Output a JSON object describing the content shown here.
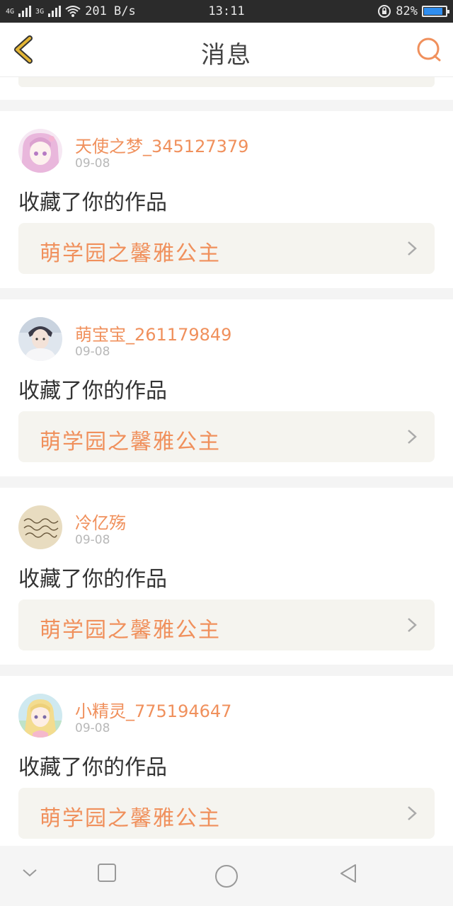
{
  "status_bar": {
    "network_1": "4G",
    "network_2": "3G",
    "speed": "201 B/s",
    "time": "13:11",
    "battery_text": "82%",
    "battery_level": 0.82
  },
  "header": {
    "title": "消息",
    "accent_color": "#f0905c",
    "back_icon_color": "#e3b535"
  },
  "notifications": [
    {
      "username": "天使之梦_345127379",
      "date": "09-08",
      "action": "收藏了你的作品",
      "work_title": "萌学园之馨雅公主",
      "avatar": "pink-hair-girl"
    },
    {
      "username": "萌宝宝_261179849",
      "date": "09-08",
      "action": "收藏了你的作品",
      "work_title": "萌学园之馨雅公主",
      "avatar": "boy-photo"
    },
    {
      "username": "冷亿殇",
      "date": "09-08",
      "action": "收藏了你的作品",
      "work_title": "萌学园之馨雅公主",
      "avatar": "handwriting"
    },
    {
      "username": "小精灵_775194647",
      "date": "09-08",
      "action": "收藏了你的作品",
      "work_title": "萌学园之馨雅公主",
      "avatar": "anime-girl"
    }
  ]
}
